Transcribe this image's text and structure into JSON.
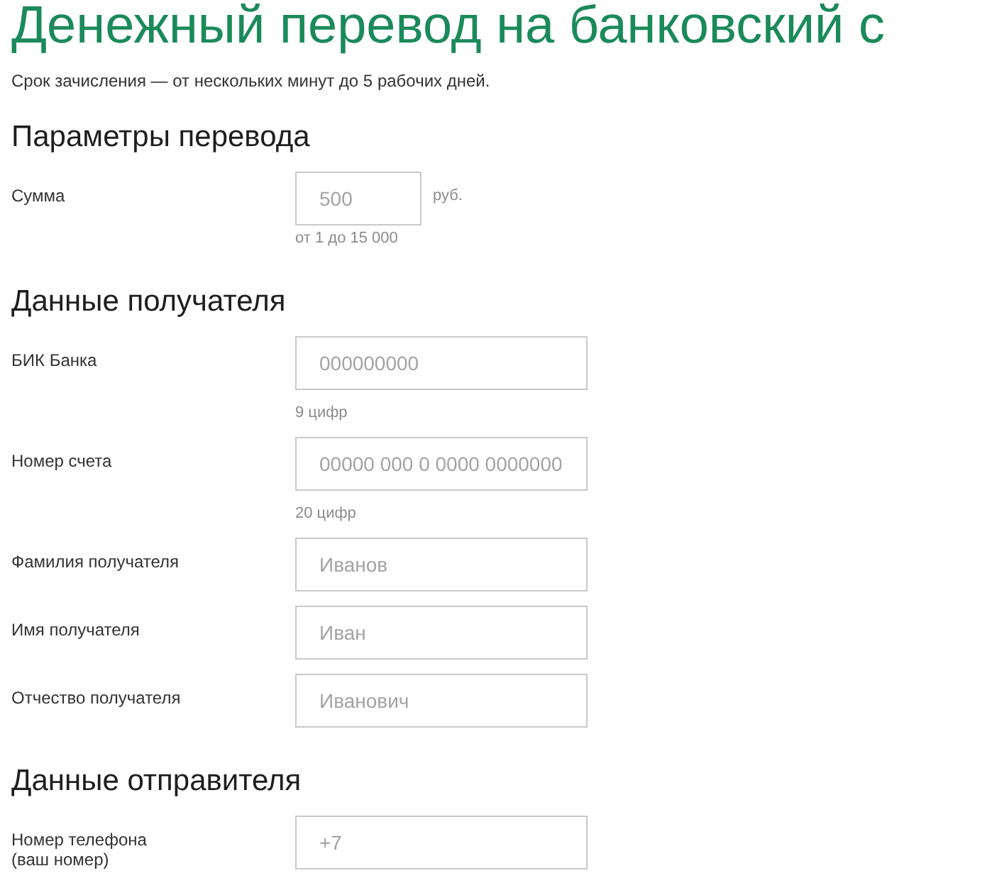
{
  "title": "Денежный перевод на банковский с",
  "subtitle": "Срок зачисления — от нескольких минут до 5 рабочих дней.",
  "sections": [
    {
      "heading": "Параметры перевода",
      "fields": [
        {
          "kind": "short",
          "label": "Сумма",
          "placeholder": "500",
          "unit": "руб.",
          "hint": "от 1 до 15 000"
        }
      ]
    },
    {
      "heading": "Данные получателя",
      "fields": [
        {
          "kind": "wide",
          "label": "БИК Банка",
          "placeholder": "000000000",
          "hint": "9 цифр"
        },
        {
          "kind": "wide",
          "label": "Номер счета",
          "placeholder": "00000 000 0 0000 0000000",
          "hint": "20 цифр"
        },
        {
          "kind": "wide",
          "label": "Фамилия получателя",
          "placeholder": "Иванов"
        },
        {
          "kind": "wide",
          "label": "Имя получателя",
          "placeholder": "Иван"
        },
        {
          "kind": "wide",
          "label": "Отчество получателя",
          "placeholder": "Иванович"
        }
      ]
    },
    {
      "heading": "Данные отправителя",
      "fields": [
        {
          "kind": "wide",
          "label": "Номер телефона\n(ваш номер)",
          "placeholder": "+7"
        }
      ]
    }
  ]
}
